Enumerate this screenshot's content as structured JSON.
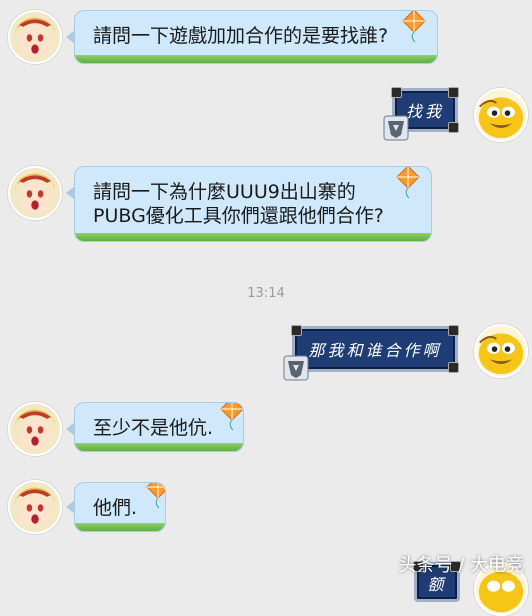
{
  "messages": [
    {
      "side": "left",
      "text": "請問一下遊戲加加合作的是要找誰?"
    },
    {
      "side": "right",
      "text": "找我"
    },
    {
      "side": "left",
      "line1": "請問一下為什麼UUU9出山寨的",
      "line2": "PUBG優化工具你們還跟他們合作?"
    },
    {
      "side": "right",
      "text": "那我和谁合作啊"
    },
    {
      "side": "left",
      "text": "至少不是他伉."
    },
    {
      "side": "left",
      "text": "他們."
    },
    {
      "side": "right",
      "text": "额"
    }
  ],
  "timestamp": "13:14",
  "watermark": "头条号 / 大电竞",
  "colors": {
    "left_bubble": "#cfe8fb",
    "right_bubble": "#1f3c75",
    "background": "#ebebeb"
  },
  "icons": [
    "girl-avatar",
    "yellow-creature-avatar",
    "kite-icon",
    "transformer-emblem-icon"
  ]
}
